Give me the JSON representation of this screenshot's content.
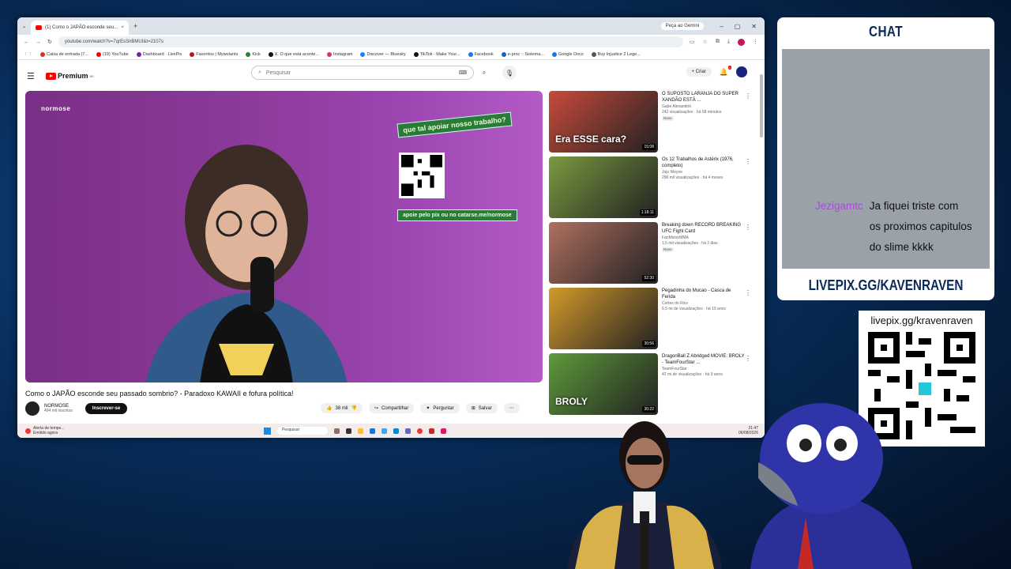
{
  "browser": {
    "tab_title": "(1) Como o JAPÃO esconde seu...",
    "gemini_label": "Peça ao Gemini",
    "url": "youtube.com/watch?v=7qrEsSnBMUI&t=2107s",
    "bookmarks": [
      {
        "label": "Caixa de entrada (7...",
        "color": "#d93025"
      },
      {
        "label": "(19) YouTube",
        "color": "#ff0000"
      },
      {
        "label": "Dashboard · LivePix",
        "color": "#7b1fa2"
      },
      {
        "label": "Favoritos | Mywolants",
        "color": "#b71c1c"
      },
      {
        "label": "Kick",
        "color": "#2e7d32"
      },
      {
        "label": "X. O que está aconte...",
        "color": "#111111"
      },
      {
        "label": "Instagram",
        "color": "#e1306c"
      },
      {
        "label": "Discover — Bluesky",
        "color": "#1185fe"
      },
      {
        "label": "TikTok - Make Your...",
        "color": "#111111"
      },
      {
        "label": "Facebook",
        "color": "#1877f2"
      },
      {
        "label": "e-proc :: Sistema...",
        "color": "#1565c0"
      },
      {
        "label": "Google Docs",
        "color": "#1a73e8"
      },
      {
        "label": "Buy Injustice 2 Lege...",
        "color": "#455a64"
      }
    ]
  },
  "youtube": {
    "logo_text": "Premium",
    "logo_region": "BR",
    "search_placeholder": "Pesquisar",
    "create_label": "+ Criar",
    "notif_count": "1",
    "video": {
      "watermark": "normose",
      "promo_top": "que tal apoiar nosso trabalho?",
      "promo_bottom": "apoie pelo pix ou no catarse.me/normose",
      "title": "Como o JAPÃO esconde seu passado sombrio? - Paradoxo KAWAII e fofura política!",
      "channel": "NORMOSE",
      "subs": "494 mil inscritos",
      "subscribe_label": "Inscrever-se",
      "likes": "38 mil",
      "share_label": "Compartilhar",
      "ask_label": "Perguntar",
      "save_label": "Salvar"
    },
    "recommended": [
      {
        "title": "O SUPOSTO LARANJA DO SUPER XANDÃO ESTÁ ...",
        "channel": "Gabe Alexandriti",
        "meta": "242 visualizações · há 58 minutos",
        "badge": "Novo",
        "duration": "15:08",
        "overlay": "Era ESSE cara?",
        "bg": "#c84a3a"
      },
      {
        "title": "Os 12 Trabalhos de Astérix (1976, completo)",
        "channel": "Jojo Weyne",
        "meta": "296 mil visualizações · há 4 meses",
        "badge": "",
        "duration": "1:18:11",
        "overlay": "",
        "bg": "#7a9a40"
      },
      {
        "title": "Breaking down RECORD BREAKING UFC Fight Card",
        "channel": "FanMixtorMMA",
        "meta": "1,5 mil visualizações · há 2 dias",
        "badge": "Novo",
        "duration": "52:30",
        "overlay": "",
        "bg": "#b07060"
      },
      {
        "title": "Pegadinha do Mucao - Casca de Ferida",
        "channel": "Cortes do Rico",
        "meta": "6,5 mi de visualizações · há 19 anos",
        "badge": "",
        "duration": "30:56",
        "overlay": "",
        "bg": "#d39a2a"
      },
      {
        "title": "DragonBall Z Abridged MOVIE: BROLY - TeamFourStar ...",
        "channel": "TeamFourStar",
        "meta": "42 mi de visualizações · há 9 anos",
        "badge": "",
        "duration": "30:22",
        "overlay": "BROLY",
        "bg": "#5e9a3a"
      }
    ]
  },
  "taskbar": {
    "alert_title": "Alerta de tempe...",
    "alert_sub": "Emitido agora",
    "search_label": "Pesquisar",
    "time": "21:47",
    "date": "06/08/2026"
  },
  "chat": {
    "title": "CHAT",
    "user": "Jezigamtc",
    "message": "Ja fiquei triste com os proximos capitulos do slime kkkk",
    "footer": "LIVEPIX.GG/KAVENRAVEN"
  },
  "qr": {
    "label": "livepix.gg/kravenraven"
  }
}
